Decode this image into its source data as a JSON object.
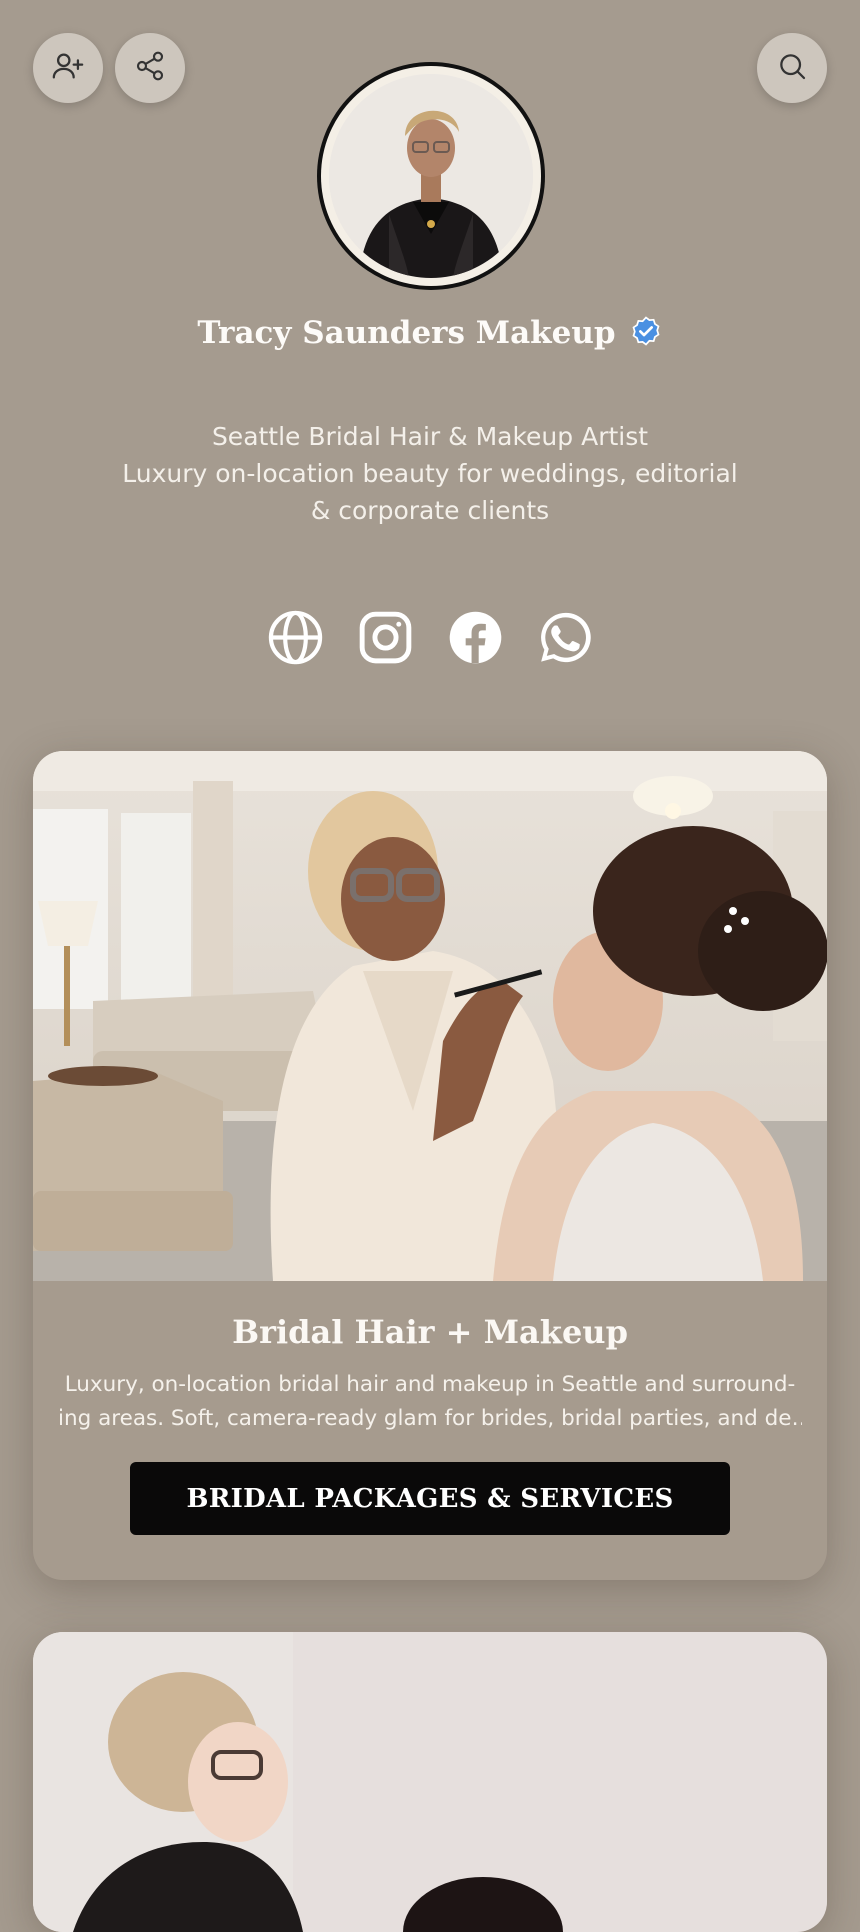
{
  "header": {
    "add_contact_icon": "user-plus-icon",
    "share_icon": "share-icon",
    "search_icon": "search-icon"
  },
  "profile": {
    "name": "Tracy Saunders Makeup",
    "verified_icon": "verified-badge-icon",
    "bio_lines": [
      "Seattle Bridal Hair & Makeup Artist",
      "Luxury on-location beauty for weddings, editorial",
      "& corporate clients"
    ]
  },
  "socials": [
    "globe-icon",
    "instagram-icon",
    "facebook-icon",
    "whatsapp-icon"
  ],
  "cards": [
    {
      "title": "Bridal Hair + Makeup",
      "desc_lines": [
        "Luxury, on-location bridal hair and makeup in Seattle and surround-",
        "ing areas. Soft, camera-ready glam for brides, bridal parties, and de…"
      ],
      "cta": "BRIDAL PACKAGES & SERVICES"
    }
  ],
  "colors": {
    "background": "#a59b8f",
    "button": "#0a0909",
    "verified": "#4a90e2"
  }
}
